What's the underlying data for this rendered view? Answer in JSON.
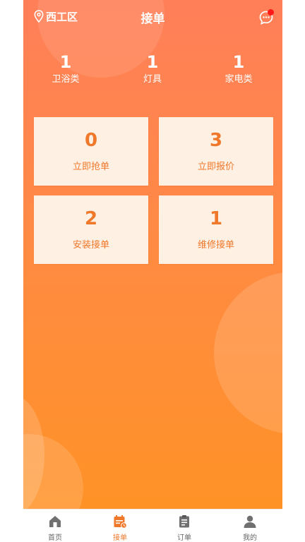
{
  "header": {
    "location": "西工区",
    "title": "接单"
  },
  "stats": [
    {
      "value": "1",
      "label": "卫浴类"
    },
    {
      "value": "1",
      "label": "灯具"
    },
    {
      "value": "1",
      "label": "家电类"
    }
  ],
  "cards": [
    {
      "value": "0",
      "label": "立即抢单"
    },
    {
      "value": "3",
      "label": "立即报价"
    },
    {
      "value": "2",
      "label": "安装接单"
    },
    {
      "value": "1",
      "label": "维修接单"
    }
  ],
  "tabbar": [
    {
      "label": "首页",
      "icon": "home-icon",
      "active": false
    },
    {
      "label": "接单",
      "icon": "calendar-clock-icon",
      "active": true
    },
    {
      "label": "订单",
      "icon": "clipboard-icon",
      "active": false
    },
    {
      "label": "我的",
      "icon": "user-icon",
      "active": false
    }
  ],
  "colors": {
    "accent": "#f0782a",
    "gradient_top": "#ff7f59",
    "gradient_bottom": "#ff9226",
    "card_bg": "#fff0e4",
    "notification_dot": "#ff1a1a"
  }
}
